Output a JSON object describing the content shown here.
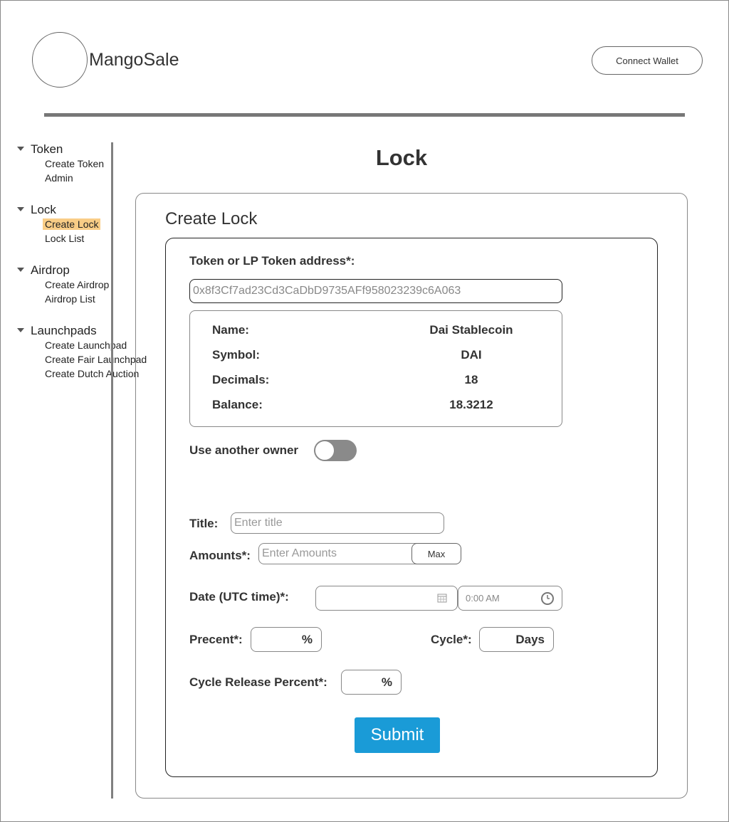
{
  "header": {
    "brand": "MangoSale",
    "connect_wallet": "Connect Wallet"
  },
  "sidebar": {
    "groups": [
      {
        "label": "Token",
        "items": [
          "Create Token",
          "Admin"
        ]
      },
      {
        "label": "Lock",
        "items": [
          "Create Lock",
          "Lock List"
        ]
      },
      {
        "label": "Airdrop",
        "items": [
          "Create Airdrop",
          "Airdrop List"
        ]
      },
      {
        "label": "Launchpads",
        "items": [
          "Create Launchpad",
          "Create Fair Launchpad",
          "Create Dutch Auction"
        ]
      }
    ],
    "active_item": "Create Lock"
  },
  "page": {
    "title": "Lock",
    "card_title": "Create Lock"
  },
  "form": {
    "address_label": "Token or LP Token address*:",
    "address_value": "0x8f3Cf7ad23Cd3CaDbD9735AFf958023239c6A063",
    "token_info": [
      {
        "key": "Name:",
        "value": "Dai Stablecoin"
      },
      {
        "key": "Symbol:",
        "value": "DAI"
      },
      {
        "key": "Decimals:",
        "value": "18"
      },
      {
        "key": "Balance:",
        "value": "18.3212"
      }
    ],
    "another_owner_label": "Use another owner",
    "another_owner_enabled": false,
    "title_label": "Title:",
    "title_placeholder": "Enter title",
    "amounts_label": "Amounts*:",
    "amounts_placeholder": "Enter Amounts",
    "max_label": "Max",
    "date_label": "Date (UTC time)*:",
    "time_value": "0:00 AM",
    "percent_label": "Precent*:",
    "percent_unit": "%",
    "cycle_label": "Cycle*:",
    "cycle_unit": "Days",
    "cycle_release_label": "Cycle Release Percent*:",
    "cycle_release_unit": "%",
    "submit_label": "Submit"
  },
  "colors": {
    "submit": "#1a9bd7",
    "active_nav": "#f9cd86",
    "toggle_track": "#8a8a8a"
  },
  "icons": {
    "calendar": "calendar-icon",
    "clock": "clock-icon",
    "collapse": "triangle-down-icon"
  }
}
